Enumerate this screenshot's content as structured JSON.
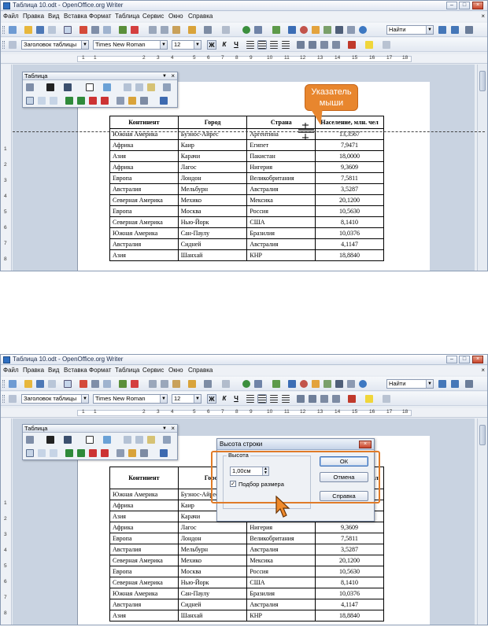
{
  "window": {
    "title": "Таблица 10.odt - OpenOffice.org Writer"
  },
  "menu": [
    "Файл",
    "Правка",
    "Вид",
    "Вставка",
    "Формат",
    "Таблица",
    "Сервис",
    "Окно",
    "Справка"
  ],
  "menu_close": "×",
  "standard_toolbar": {
    "find_placeholder": "Найти"
  },
  "formatting_toolbar": {
    "style": "Заголовок таблицы",
    "font": "Times New Roman",
    "size": "12",
    "bold": "Ж",
    "italic": "К",
    "underline": "Ч"
  },
  "ruler": {
    "h_numbers": [
      "1",
      "1",
      "2",
      "3",
      "4",
      "5",
      "6",
      "7",
      "8",
      "9",
      "10",
      "11",
      "12",
      "13",
      "14",
      "15",
      "16",
      "17",
      "18"
    ],
    "v_numbers": [
      "1",
      "2",
      "3",
      "4",
      "5",
      "6",
      "7",
      "8",
      "9"
    ]
  },
  "table_panel": {
    "title": "Таблица"
  },
  "callout": {
    "text": "Указатель мыши"
  },
  "table": {
    "headers": [
      "Континент",
      "Город",
      "Страна",
      "Население, млн. чел"
    ],
    "rows": [
      [
        "Южная Америка",
        "Буэнос-Айрес",
        "Аргентина",
        "13,3567"
      ],
      [
        "Африка",
        "Каир",
        "Египет",
        "7,9471"
      ],
      [
        "Азия",
        "Карачи",
        "Пакистан",
        "18,0000"
      ],
      [
        "Африка",
        "Лагос",
        "Нигерия",
        "9,3609"
      ],
      [
        "Европа",
        "Лондон",
        "Великобритания",
        "7,5811"
      ],
      [
        "Австралия",
        "Мельбурн",
        "Австралия",
        "3,5287"
      ],
      [
        "Северная Америка",
        "Мехико",
        "Мексика",
        "20,1200"
      ],
      [
        "Европа",
        "Москва",
        "Россия",
        "10,5630"
      ],
      [
        "Северная Америка",
        "Нью-Йорк",
        "США",
        "8,1410"
      ],
      [
        "Южная Америка",
        "Сан-Паулу",
        "Бразилия",
        "10,0376"
      ],
      [
        "Австралия",
        "Сидней",
        "Австралия",
        "4,1147"
      ],
      [
        "Азия",
        "Шанхай",
        "КНР",
        "18,8840"
      ]
    ]
  },
  "dialog": {
    "title": "Высота строки",
    "group": "Высота",
    "height_value": "1,00см",
    "fit_label": "Подбор размера",
    "fit_checked": "✓",
    "ok": "ОК",
    "cancel": "Отмена",
    "help": "Справка"
  }
}
